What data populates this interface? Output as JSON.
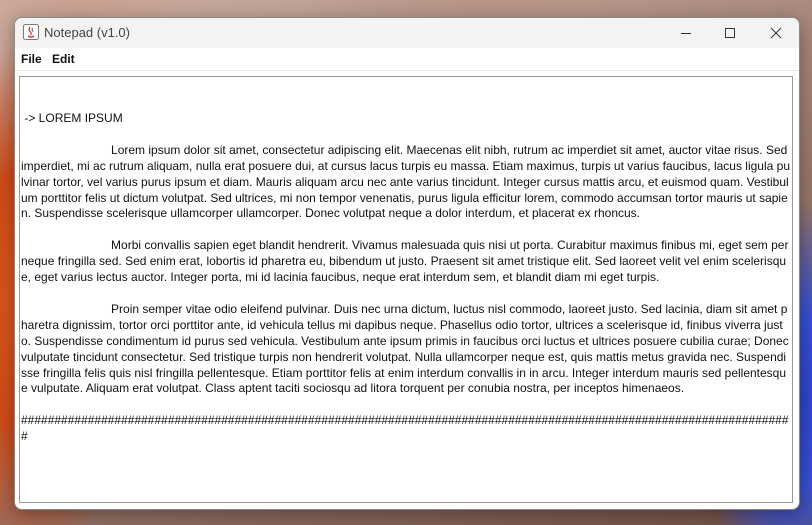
{
  "window": {
    "title": "Notepad (v1.0)"
  },
  "titlebar_buttons": {
    "minimize": "minimize-icon",
    "maximize": "maximize-icon",
    "close": "close-icon"
  },
  "menu": {
    "file": "File",
    "edit": "Edit"
  },
  "editor": {
    "content": " -> LOREM IPSUM\n\n                           Lorem ipsum dolor sit amet, consectetur adipiscing elit. Maecenas elit nibh, rutrum ac imperdiet sit amet, auctor vitae risus. Sed imperdiet, mi ac rutrum aliquam, nulla erat posuere dui, at cursus lacus turpis eu massa. Etiam maximus, turpis ut varius faucibus, lacus ligula pulvinar tortor, vel varius purus ipsum et diam. Mauris aliquam arcu nec ante varius tincidunt. Integer cursus mattis arcu, et euismod quam. Vestibulum porttitor felis ut dictum volutpat. Sed ultrices, mi non tempor venenatis, purus ligula efficitur lorem, commodo accumsan tortor mauris ut sapien. Suspendisse scelerisque ullamcorper ullamcorper. Donec volutpat neque a dolor interdum, et placerat ex rhoncus.\n\n                           Morbi convallis sapien eget blandit hendrerit. Vivamus malesuada quis nisi ut porta. Curabitur maximus finibus mi, eget sem per neque fringilla sed. Sed enim erat, lobortis id pharetra eu, bibendum ut justo. Praesent sit amet tristique elit. Sed laoreet velit vel enim scelerisque, eget varius lectus auctor. Integer porta, mi id lacinia faucibus, neque erat interdum sem, et blandit diam mi eget turpis.\n\n                           Proin semper vitae odio eleifend pulvinar. Duis nec urna dictum, luctus nisl commodo, laoreet justo. Sed lacinia, diam sit amet pharetra dignissim, tortor orci porttitor ante, id vehicula tellus mi dapibus neque. Phasellus odio tortor, ultrices a scelerisque id, finibus viverra justo. Suspendisse condimentum id purus sed vehicula. Vestibulum ante ipsum primis in faucibus orci luctus et ultrices posuere cubilia curae; Donec vulputate tincidunt consectetur. Sed tristique turpis non hendrerit volutpat. Nulla ullamcorper neque est, quis mattis metus gravida nec. Suspendisse fringilla felis quis nisl fringilla pellentesque. Etiam porttitor felis at enim interdum convallis in in arcu. Integer interdum mauris sed pellentesque vulputate. Aliquam erat volutpat. Class aptent taciti sociosqu ad litora torquent per conubia nostra, per inceptos himenaeos.\n\n####################################################################################################################"
  }
}
